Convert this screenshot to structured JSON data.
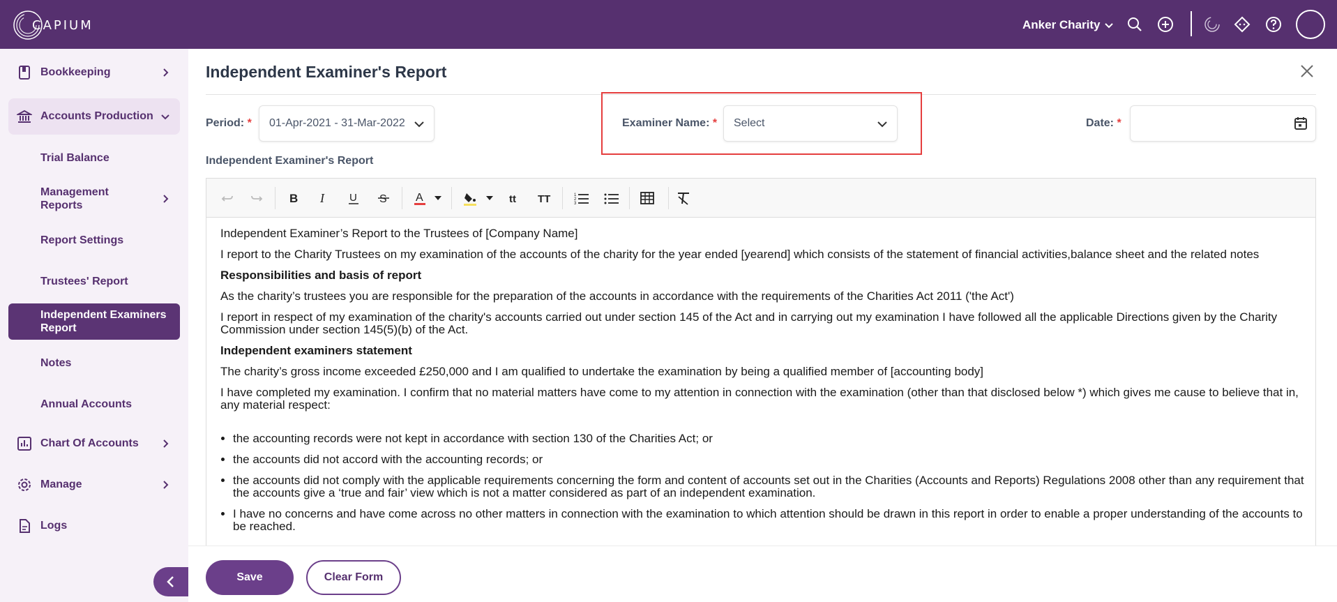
{
  "app": {
    "logo_text": "CAPIUM"
  },
  "header": {
    "organisation": "Anker Charity"
  },
  "sidebar": {
    "items": [
      {
        "label": "Bookkeeping"
      },
      {
        "label": "Accounts Production"
      },
      {
        "label": "Chart Of Accounts"
      },
      {
        "label": "Manage"
      },
      {
        "label": "Logs"
      }
    ],
    "sub_items": [
      {
        "label": "Trial Balance"
      },
      {
        "label": "Management Reports"
      },
      {
        "label": "Report Settings"
      },
      {
        "label": "Trustees' Report"
      },
      {
        "label": "Independent Examiners Report"
      },
      {
        "label": "Notes"
      },
      {
        "label": "Annual Accounts"
      }
    ]
  },
  "page": {
    "title": "Independent Examiner's Report",
    "period_label": "Period:",
    "period_value": "01-Apr-2021 - 31-Mar-2022",
    "examiner_label": "Examiner Name:",
    "examiner_value": "Select",
    "date_label": "Date:",
    "date_value": "",
    "required_mark": "*",
    "section_label": "Independent Examiner's Report"
  },
  "editor": {
    "toolbar_icons": [
      "undo-icon",
      "redo-icon",
      "bold-icon",
      "italic-icon",
      "underline-icon",
      "strikethrough-icon",
      "text-color-icon",
      "highlight-color-icon",
      "font-size-icon",
      "text-transform-icon",
      "ordered-list-icon",
      "unordered-list-icon",
      "table-icon",
      "clear-format-icon"
    ],
    "text_color": "#e53e3e",
    "highlight_color": "#f6e05e",
    "paragraphs": [
      "Independent Examiner’s Report to the Trustees of [Company Name]",
      "I report to the Charity Trustees on my examination of the accounts of the charity for the year ended [yearend] which consists of the statement of financial activities,balance sheet and the related notes",
      "Responsibilities and basis of report",
      "As the charity’s trustees you are responsible for the preparation of the accounts in accordance with the requirements of the Charities Act 2011 ('the Act')",
      "I report in respect of my examination of the charity's accounts carried out under section 145 of the Act and in carrying out my examination I have followed all the applicable Directions given by the Charity Commission under section 145(5)(b) of the Act.",
      "Independent examiners statement",
      "The charity’s gross income exceeded £250,000 and I am qualified to undertake the examination by being a qualified member of [accounting body]",
      "I have completed my examination. I confirm that no material matters have come to my attention in connection with the examination (other than that disclosed below *) which gives me cause to believe that in, any material respect:"
    ],
    "bullets": [
      "the accounting records were not kept in accordance with section 130 of the Charities Act; or",
      "the accounts did not accord with the accounting records; or",
      "the accounts did not comply with the applicable requirements concerning the form and content of accounts set out in the Charities (Accounts and Reports) Regulations 2008 other than any requirement that the accounts give a ‘true and fair’ view which is not a matter considered as part of an independent examination.",
      "I have no concerns and have come across no other matters in connection with the examination to which attention should be drawn in this report in order to enable a proper understanding of the accounts to be reached."
    ]
  },
  "footer": {
    "save_label": "Save",
    "clear_label": "Clear Form"
  },
  "colors": {
    "brand": "#56306f",
    "accent": "#6b3f8a",
    "required": "#e53e3e"
  }
}
